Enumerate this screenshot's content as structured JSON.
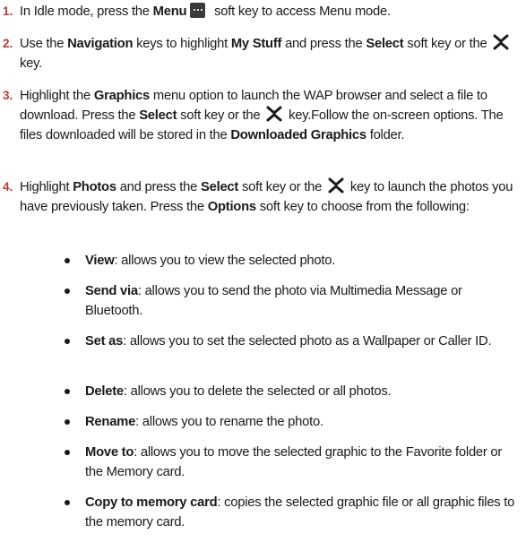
{
  "steps": [
    {
      "num": "1.",
      "parts": [
        "In Idle mode, press the ",
        "Menu",
        " soft key to access Menu mode."
      ]
    },
    {
      "num": "2.",
      "parts": [
        "Use the ",
        "Navigation",
        " keys to highlight ",
        "My Stuff",
        " and press the ",
        "Select",
        " soft key or the ",
        " key."
      ]
    },
    {
      "num": "3.",
      "parts": [
        "Highlight the ",
        "Graphics",
        " menu option to launch the WAP browser and select a file to download. Press the ",
        "Select",
        " soft key or the ",
        " key.Follow the on-screen options. The files downloaded will be stored in the ",
        "Downloaded Graphics",
        " folder."
      ]
    },
    {
      "num": "4.",
      "parts": [
        "Highlight ",
        "Photos",
        " and press the ",
        "Select",
        " soft key or the ",
        " key to launch the photos you have previously taken. Press the ",
        "Options",
        " soft key to choose from the following:"
      ]
    }
  ],
  "options": [
    {
      "term": "View",
      "desc": ": allows you to view the selected photo."
    },
    {
      "term": "Send via",
      "desc": ": allows you to send the photo via Multimedia Message or Bluetooth."
    },
    {
      "term": "Set as",
      "desc": ": allows you to set the selected photo as a Wallpaper or Caller ID."
    },
    {
      "term": "Delete",
      "desc": ": allows you to delete the selected or all photos."
    },
    {
      "term": "Rename",
      "desc": ": allows you to rename the photo."
    },
    {
      "term": "Move to",
      "desc": ": allows you to move the selected graphic to the Favorite folder or the Memory card."
    },
    {
      "term": "Copy to memory card",
      "desc": ": copies the selected graphic file or all graphic files to the memory card."
    }
  ],
  "icons": {
    "menu_key": "menu-softkey-icon",
    "select_key": "select-x-key-icon"
  },
  "colors": {
    "step_number": "#c0392b",
    "text": "#1a1a1a"
  }
}
